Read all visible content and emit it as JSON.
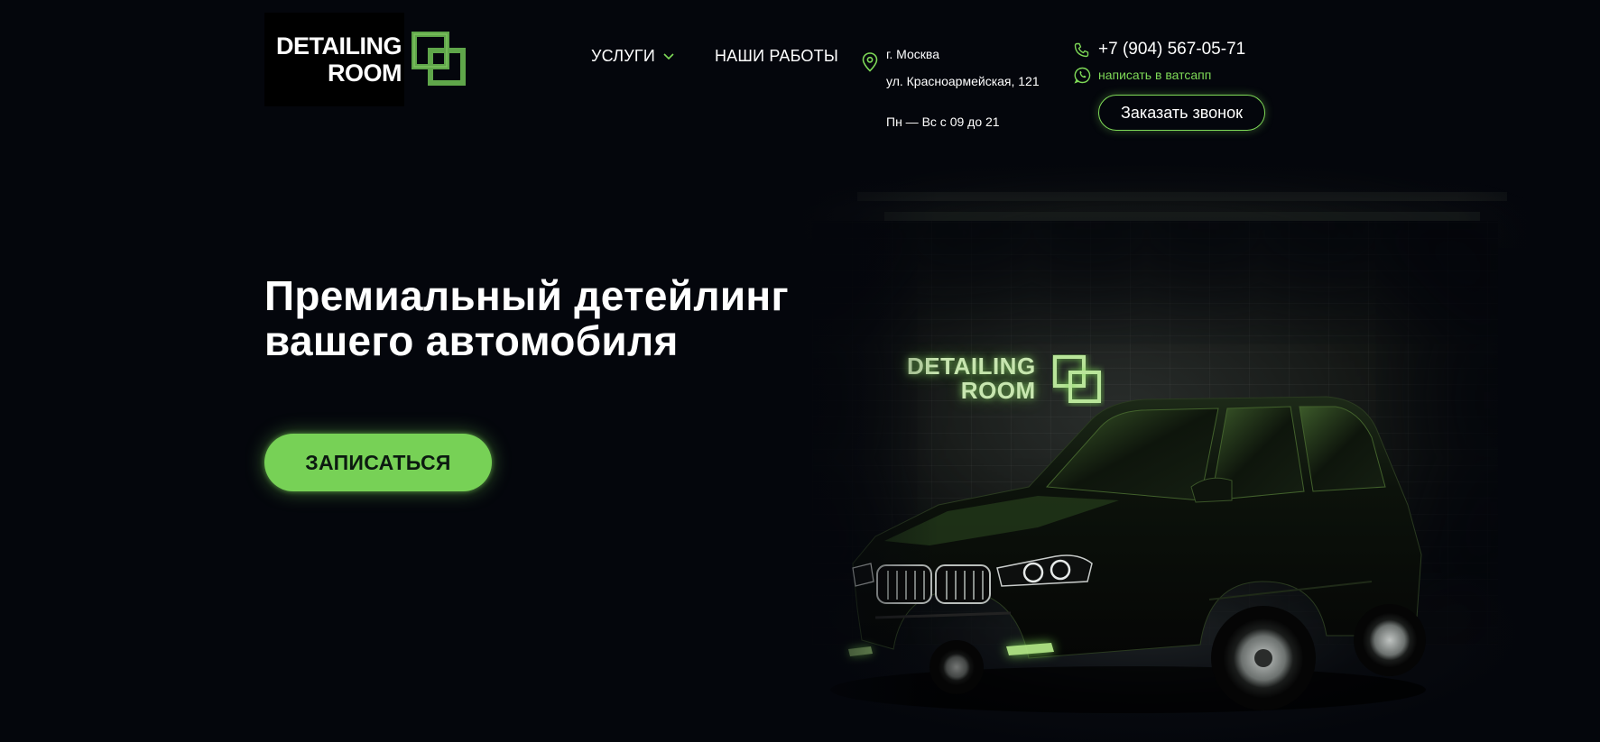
{
  "brand": {
    "logo_line1": "DETAILING",
    "logo_line2": "ROOM",
    "accent_color": "#7ed957"
  },
  "nav": {
    "items": [
      {
        "label": "УСЛУГИ",
        "has_dropdown": true
      },
      {
        "label": "НАШИ РАБОТЫ",
        "has_dropdown": false
      }
    ]
  },
  "contacts": {
    "city": "г. Москва",
    "street": "ул. Красноармейская, 121",
    "hours": "Пн — Вс с 09 до 21",
    "phone": "+7 (904) 567-05-71",
    "whatsapp_label": "написать в ватсапп",
    "call_button": "Заказать звонок"
  },
  "hero": {
    "title_line1": "Премиальный детейлинг",
    "title_line2": "вашего автомобиля",
    "cta_label": "ЗАПИСАТЬСЯ",
    "wall_logo_line1": "DETAILING",
    "wall_logo_line2": "ROOM"
  },
  "icons": {
    "dropdown": "chevron-down-icon",
    "location": "map-pin-icon",
    "phone": "phone-icon",
    "whatsapp": "whatsapp-icon"
  }
}
